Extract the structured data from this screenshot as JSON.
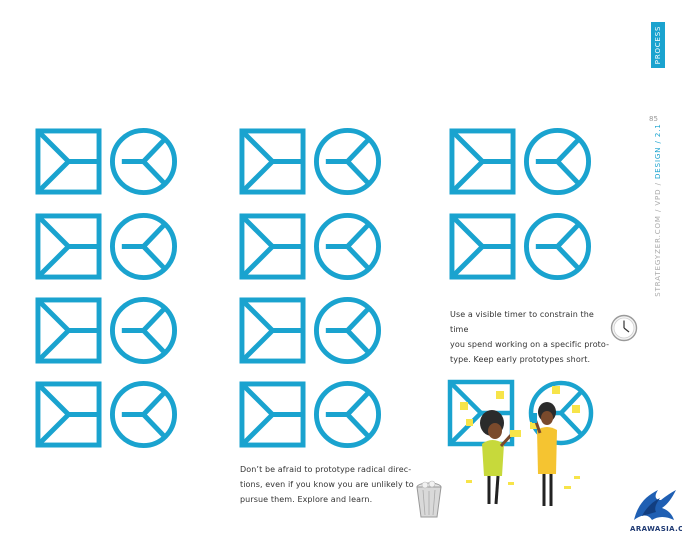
{
  "side_tab": {
    "label": "PROCESS"
  },
  "page_number": "85",
  "running_header": {
    "prefix": "STRATEGYZER.COM / VPD / ",
    "highlight": "DESIGN / 2.1"
  },
  "notes": {
    "timer": [
      "Use a visible timer to constrain the time",
      "you spend working on a specific proto-",
      "type. Keep early prototypes short."
    ],
    "radical": [
      "Don’t be afraid to prototype radical direc-",
      "tions, even if you know you are unlikely to",
      "pursue them. Explore and learn."
    ]
  },
  "logo": {
    "text": "ARAWASIA.ORG"
  },
  "colors": {
    "accent": "#1aa3cf",
    "sticky": "#f7e449",
    "shirt_green": "#c7d93b",
    "shirt_yellow": "#f5c431"
  }
}
